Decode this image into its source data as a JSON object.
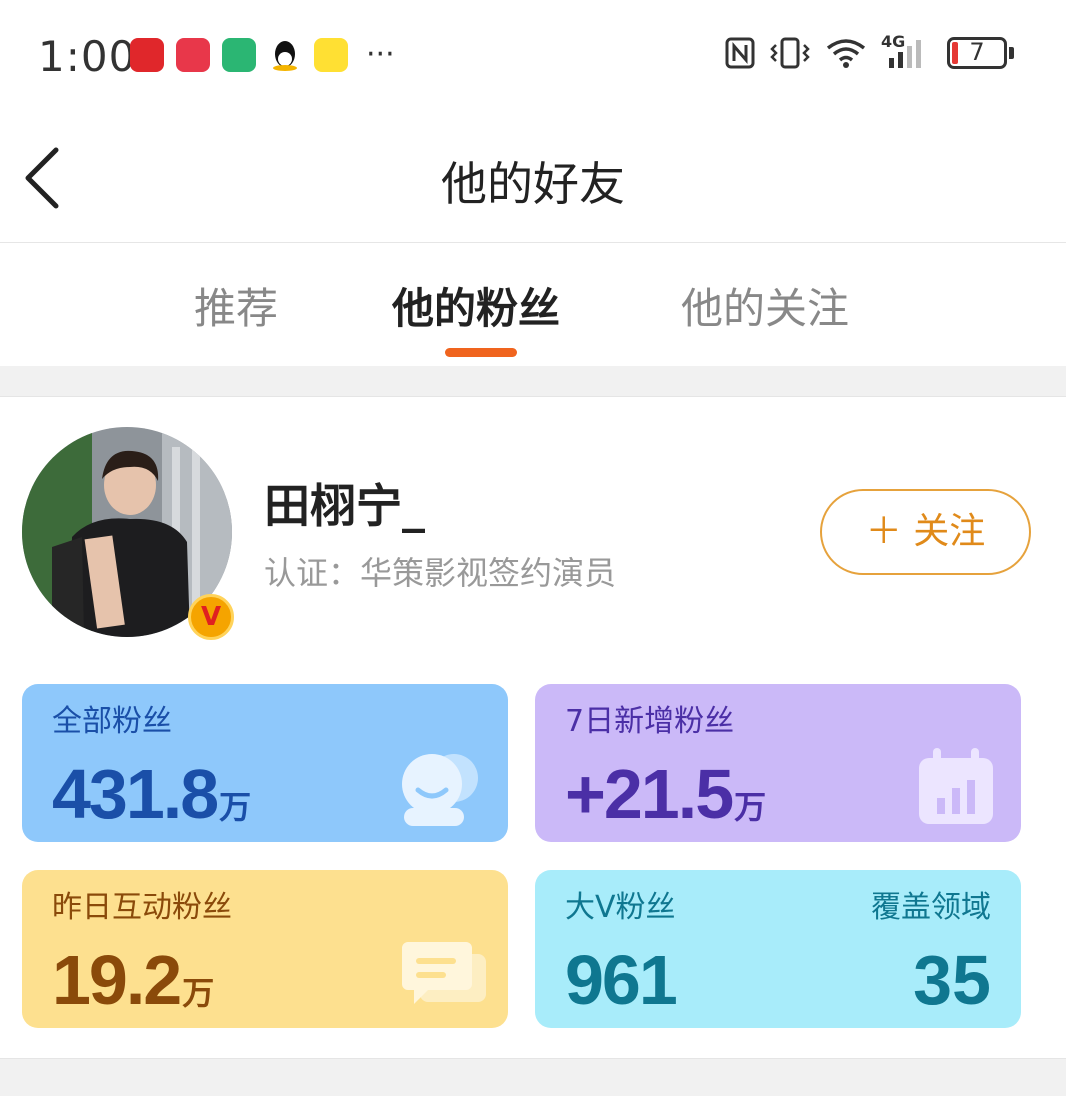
{
  "status_bar": {
    "time": "1:00",
    "app_icons": [
      "huawei-appgallery-icon",
      "red-app-icon",
      "mi-home-icon",
      "qq-icon",
      "xianyu-icon"
    ],
    "more": "···",
    "network": "4G",
    "battery": "7"
  },
  "nav": {
    "title": "他的好友"
  },
  "tabs": [
    {
      "label": "推荐",
      "active": false
    },
    {
      "label": "他的粉丝",
      "active": true
    },
    {
      "label": "他的关注",
      "active": false
    }
  ],
  "profile": {
    "name": "田栩宁_",
    "verification": "认证：华策影视签约演员",
    "badge": "V",
    "follow_label": "＋ 关注"
  },
  "stats": {
    "all_fans": {
      "label": "全部粉丝",
      "value": "431.8",
      "unit": "万"
    },
    "new_7d": {
      "label": "7日新增粉丝",
      "value": "+21.5",
      "unit": "万"
    },
    "interactive_yesterday": {
      "label": "昨日互动粉丝",
      "value": "19.2",
      "unit": "万"
    },
    "big_v": {
      "label": "大V粉丝",
      "value": "961",
      "label2": "覆盖领域",
      "value2": "35"
    }
  },
  "colors": {
    "accent": "#f0641e",
    "follow": "#e08a1a",
    "card_blue": "#8ec8fb",
    "card_purple": "#cbb9f8",
    "card_yellow": "#fde08f",
    "card_cyan": "#a8ecfa"
  }
}
